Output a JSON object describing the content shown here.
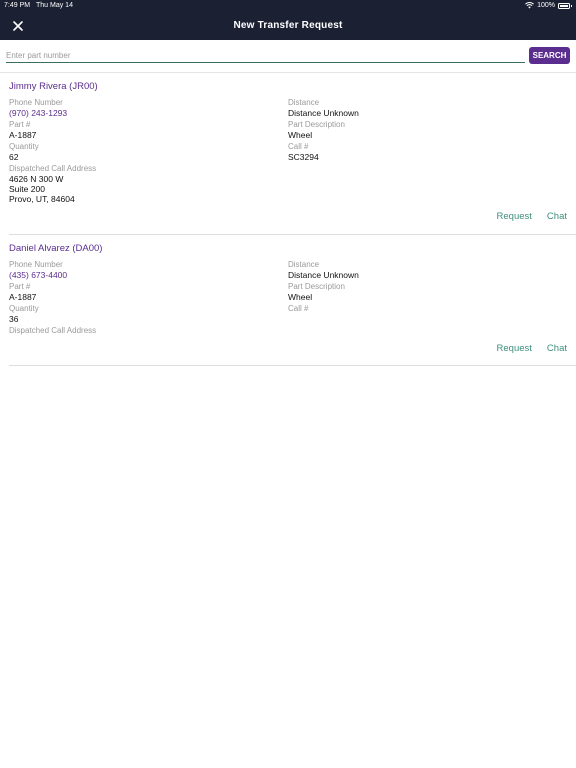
{
  "status": {
    "time": "7:49 PM",
    "date": "Thu May 14",
    "battery": "100%"
  },
  "nav": {
    "title": "New Transfer Request"
  },
  "search": {
    "placeholder": "Enter part number",
    "value": "",
    "button_label": "SEARCH"
  },
  "labels": {
    "phone": "Phone Number",
    "part": "Part #",
    "quantity": "Quantity",
    "address": "Dispatched Call Address",
    "distance": "Distance",
    "description": "Part Description",
    "call": "Call #",
    "request": "Request",
    "chat": "Chat"
  },
  "results": [
    {
      "name": "Jimmy Rivera (JR00)",
      "phone": "(970) 243-1293",
      "part": "A-1887",
      "quantity": "62",
      "address_lines": [
        "4626 N 300 W",
        "Suite 200",
        "Provo, UT, 84604"
      ],
      "distance": "Distance Unknown",
      "description": "Wheel",
      "call": "SC3294"
    },
    {
      "name": "Daniel Alvarez (DA00)",
      "phone": "(435) 673-4400",
      "part": "A-1887",
      "quantity": "36",
      "address_lines": [],
      "distance": "Distance Unknown",
      "description": "Wheel",
      "call": ""
    }
  ]
}
